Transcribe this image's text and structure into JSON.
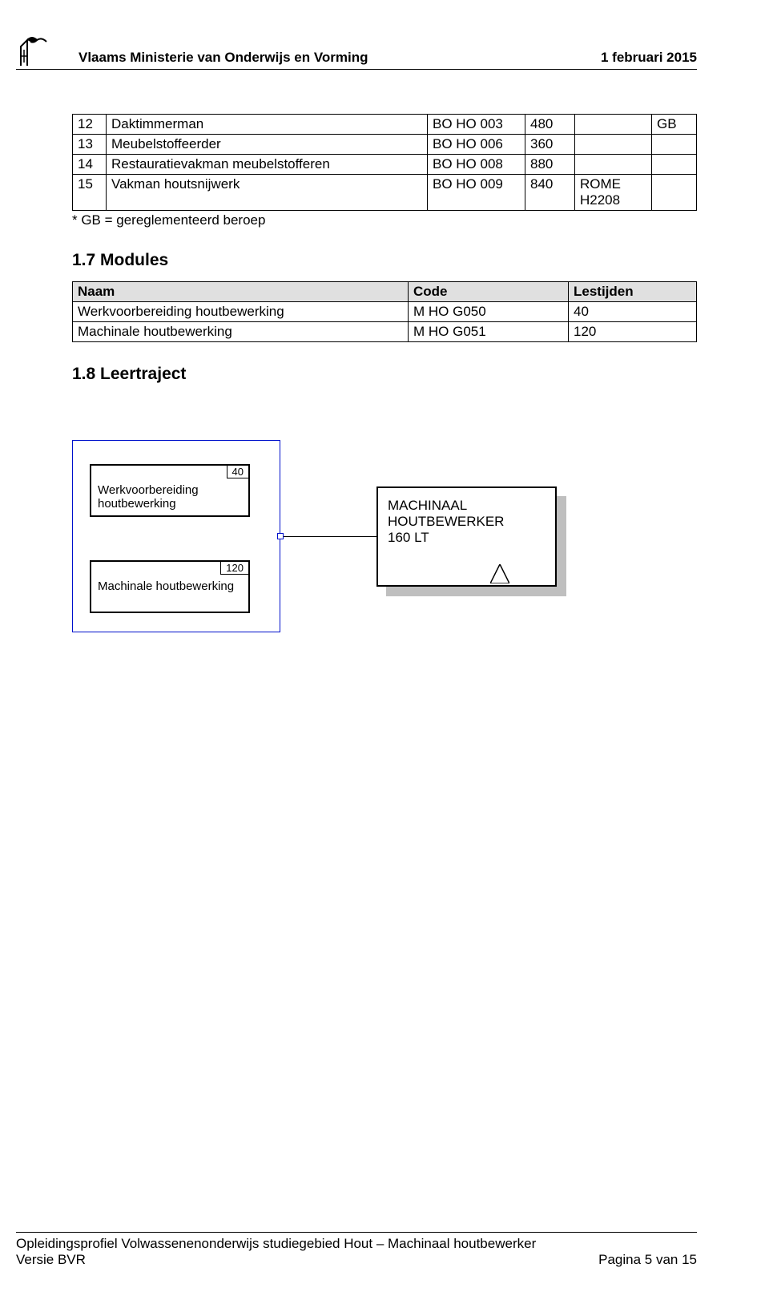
{
  "header": {
    "org": "Vlaams Ministerie van Onderwijs en Vorming",
    "date": "1 februari 2015"
  },
  "table1": {
    "rows": [
      {
        "n": "12",
        "role": "Daktimmerman",
        "code": "BO HO 003",
        "lt": "480",
        "col5": "",
        "gb": "GB"
      },
      {
        "n": "13",
        "role": "Meubelstoffeerder",
        "code": "BO HO 006",
        "lt": "360",
        "col5": "",
        "gb": ""
      },
      {
        "n": "14",
        "role": "Restauratievakman meubelstofferen",
        "code": "BO HO 008",
        "lt": "880",
        "col5": "",
        "gb": ""
      },
      {
        "n": "15",
        "role": "Vakman houtsnijwerk",
        "code": "BO HO 009",
        "lt": "840",
        "col5": "ROME H2208",
        "gb": ""
      }
    ]
  },
  "footnote": "* GB = gereglementeerd beroep",
  "sec17": "1.7   Modules",
  "modules_table": {
    "headers": {
      "name": "Naam",
      "code": "Code",
      "lt": "Lestijden"
    },
    "rows": [
      {
        "name": "Werkvoorbereiding houtbewerking",
        "code": "M HO G050",
        "lt": "40"
      },
      {
        "name": "Machinale houtbewerking",
        "code": "M HO G051",
        "lt": "120"
      }
    ]
  },
  "sec18": "1.8   Leertraject",
  "diagram": {
    "mod1": {
      "label": "Werkvoorbereiding houtbewerking",
      "lt": "40"
    },
    "mod2": {
      "label": "Machinale houtbewerking",
      "lt": "120"
    },
    "cert": {
      "line1": "MACHINAAL",
      "line2": "HOUTBEWERKER",
      "line3": "160 LT"
    }
  },
  "footer": {
    "text_l1": "Opleidingsprofiel Volwassenenonderwijs studiegebied Hout – Machinaal houtbewerker",
    "text_l2": "Versie BVR",
    "page": "Pagina 5 van 15"
  }
}
